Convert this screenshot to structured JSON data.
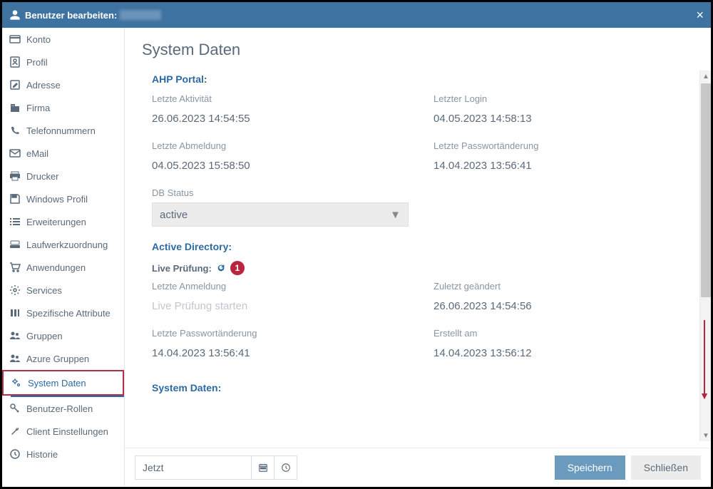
{
  "titlebar": {
    "label": "Benutzer bearbeiten:"
  },
  "sidebar": {
    "items": [
      {
        "label": "Konto"
      },
      {
        "label": "Profil"
      },
      {
        "label": "Adresse"
      },
      {
        "label": "Firma"
      },
      {
        "label": "Telefonnummern"
      },
      {
        "label": "eMail"
      },
      {
        "label": "Drucker"
      },
      {
        "label": "Windows Profil"
      },
      {
        "label": "Erweiterungen"
      },
      {
        "label": "Laufwerkzuordnung"
      },
      {
        "label": "Anwendungen"
      },
      {
        "label": "Services"
      },
      {
        "label": "Spezifische Attribute"
      },
      {
        "label": "Gruppen"
      },
      {
        "label": "Azure Gruppen"
      },
      {
        "label": "System Daten"
      },
      {
        "label": "Benutzer-Rollen"
      },
      {
        "label": "Client Einstellungen"
      },
      {
        "label": "Historie"
      }
    ]
  },
  "content": {
    "heading": "System Daten",
    "sections": {
      "ahp": {
        "title": "AHP Portal:",
        "letzte_aktivitat": {
          "label": "Letzte Aktivität",
          "value": "26.06.2023 14:54:55"
        },
        "letzter_login": {
          "label": "Letzter Login",
          "value": "04.05.2023 14:58:13"
        },
        "letzte_abmeldung": {
          "label": "Letzte Abmeldung",
          "value": "04.05.2023 15:58:50"
        },
        "letzte_pwchange": {
          "label": "Letzte Passwortänderung",
          "value": "14.04.2023 13:56:41"
        },
        "db_status": {
          "label": "DB Status",
          "value": "active"
        }
      },
      "ad": {
        "title": "Active Directory:",
        "live_label": "Live Prüfung:",
        "badge": "1",
        "letzte_anmeldung": {
          "label": "Letzte Anmeldung",
          "value": "Live Prüfung starten"
        },
        "zuletzt_geaendert": {
          "label": "Zuletzt geändert",
          "value": "26.06.2023 14:54:56"
        },
        "letzte_pwchange": {
          "label": "Letzte Passwortänderung",
          "value": "14.04.2023 13:56:41"
        },
        "erstellt_am": {
          "label": "Erstellt am",
          "value": "14.04.2023 13:56:12"
        }
      },
      "sys": {
        "title": "System Daten:"
      }
    }
  },
  "footer": {
    "date_value": "Jetzt",
    "save": "Speichern",
    "close": "Schließen"
  }
}
